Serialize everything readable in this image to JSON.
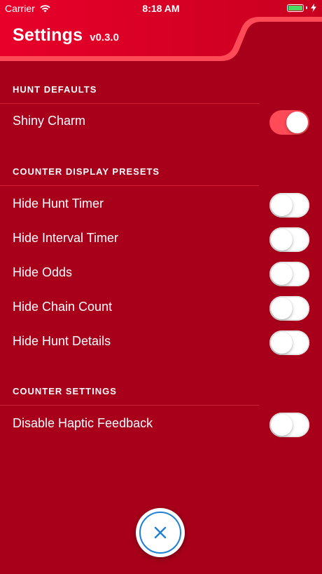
{
  "status_bar": {
    "carrier": "Carrier",
    "time": "8:18 AM",
    "battery_level": 1.0
  },
  "header": {
    "title": "Settings",
    "version": "v0.3.0"
  },
  "sections": [
    {
      "title": "HUNT DEFAULTS",
      "rows": [
        {
          "label": "Shiny Charm",
          "on": true
        }
      ]
    },
    {
      "title": "COUNTER DISPLAY PRESETS",
      "rows": [
        {
          "label": "Hide Hunt Timer",
          "on": false
        },
        {
          "label": "Hide Interval Timer",
          "on": false
        },
        {
          "label": "Hide Odds",
          "on": false
        },
        {
          "label": "Hide Chain Count",
          "on": false
        },
        {
          "label": "Hide Hunt Details",
          "on": false
        }
      ]
    },
    {
      "title": "COUNTER SETTINGS",
      "rows": [
        {
          "label": "Disable Haptic Feedback",
          "on": false
        }
      ]
    }
  ],
  "colors": {
    "background": "#a8001a",
    "header_red": "#d8001f",
    "accent_stripe": "#ff4a57",
    "toggle_on": "#ff4a57",
    "close_ring": "#1f7fd6"
  },
  "icons": {
    "wifi": "wifi-icon",
    "battery": "battery-icon",
    "charging": "bolt-icon",
    "close": "close-icon"
  }
}
